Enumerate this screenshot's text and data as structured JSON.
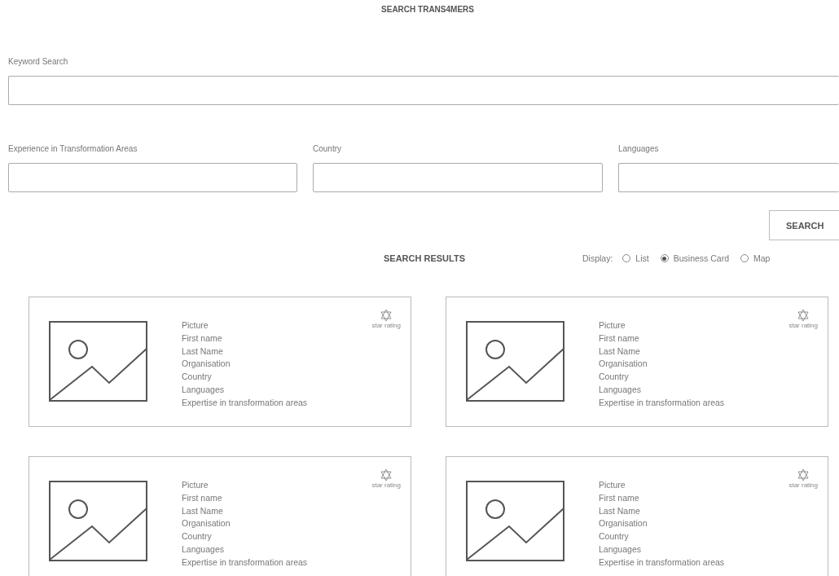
{
  "title": "SEARCH TRANS4MERS",
  "keyword_search": {
    "label": "Keyword Search"
  },
  "filters": [
    {
      "label": "Experience in Transformation Areas"
    },
    {
      "label": "Country"
    },
    {
      "label": "Languages"
    }
  ],
  "search_button": "SEARCH",
  "results": {
    "title": "SEARCH RESULTS",
    "display_label": "Display:",
    "display_options": [
      {
        "label": "List",
        "selected": false
      },
      {
        "label": "Business Card",
        "selected": true
      },
      {
        "label": "Map",
        "selected": false
      }
    ]
  },
  "cards": [
    {
      "fields": [
        "Picture",
        "First name",
        "Last Name",
        "Organisation",
        "Country",
        "Languages",
        "Expertise in transformation areas"
      ],
      "rating_label": "star rating"
    },
    {
      "fields": [
        "Picture",
        "First name",
        "Last Name",
        "Organisation",
        "Country",
        "Languages",
        "Expertise in transformation areas"
      ],
      "rating_label": "star rating"
    },
    {
      "fields": [
        "Picture",
        "First name",
        "Last Name",
        "Organisation",
        "Country",
        "Languages",
        "Expertise in transformation areas"
      ],
      "rating_label": "star rating"
    },
    {
      "fields": [
        "Picture",
        "First name",
        "Last Name",
        "Organisation",
        "Country",
        "Languages",
        "Expertise in transformation areas"
      ],
      "rating_label": "star rating"
    }
  ]
}
